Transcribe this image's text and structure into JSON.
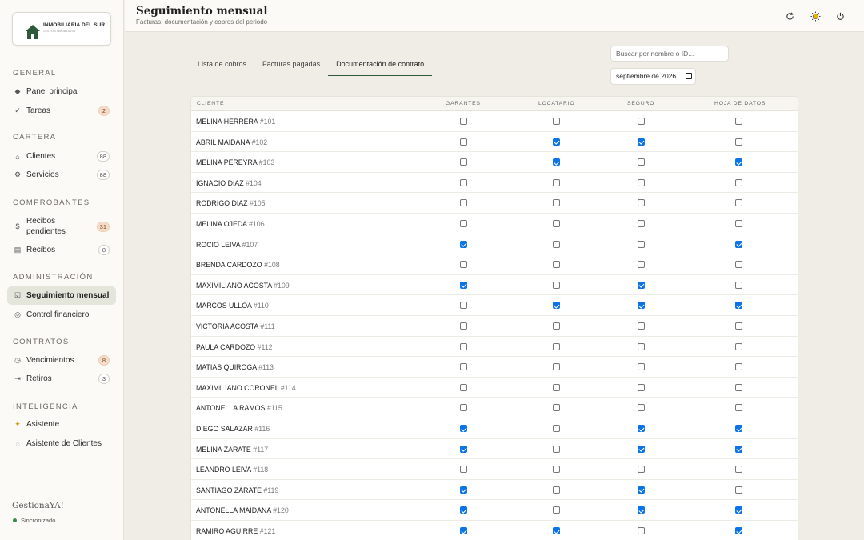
{
  "logo": {
    "title": "INMOBILIARIA DEL SUR",
    "subtitle": "GESTIÓN INMOBILIARIA"
  },
  "nav": [
    {
      "type": "section",
      "label": "GENERAL"
    },
    {
      "type": "item",
      "label": "Panel principal",
      "icon": "diamond-icon"
    },
    {
      "type": "item",
      "label": "Tareas",
      "icon": "check-icon",
      "badge": "2",
      "badge_style": "warn"
    },
    {
      "type": "section",
      "label": "CARTERA"
    },
    {
      "type": "item",
      "label": "Clientes",
      "icon": "home-icon",
      "badge": "88"
    },
    {
      "type": "item",
      "label": "Servicios",
      "icon": "gear-icon",
      "badge": "88"
    },
    {
      "type": "section",
      "label": "COMPROBANTES"
    },
    {
      "type": "item",
      "label": "Recibos pendientes",
      "icon": "dollar-icon",
      "badge": "31",
      "badge_style": "warn"
    },
    {
      "type": "item",
      "label": "Recibos",
      "icon": "receipt-icon",
      "badge": "8"
    },
    {
      "type": "section",
      "label": "ADMINISTRACIÓN"
    },
    {
      "type": "item",
      "label": "Seguimiento mensual",
      "icon": "checkbox-icon",
      "active": true
    },
    {
      "type": "item",
      "label": "Control financiero",
      "icon": "chart-icon"
    },
    {
      "type": "section",
      "label": "CONTRATOS"
    },
    {
      "type": "item",
      "label": "Vencimientos",
      "icon": "clock-icon",
      "badge": "8",
      "badge_style": "warn"
    },
    {
      "type": "item",
      "label": "Retiros",
      "icon": "exit-icon",
      "badge": "3"
    },
    {
      "type": "section",
      "label": "INTELIGENCIA"
    },
    {
      "type": "item",
      "label": "Asistente",
      "icon": "sparkle-icon"
    },
    {
      "type": "item",
      "label": "Asistente de Clientes",
      "icon": "chat-icon"
    }
  ],
  "brand": "GestionaYA!",
  "sync_status": "Sincronizado",
  "header": {
    "title": "Seguimiento mensual",
    "subtitle": "Facturas, documentación y cobros del periodo",
    "actions": [
      "refresh-icon",
      "sun-icon",
      "power-icon"
    ]
  },
  "tabs": [
    {
      "label": "Lista de cobros",
      "active": false
    },
    {
      "label": "Facturas pagadas",
      "active": false
    },
    {
      "label": "Documentación de contrato",
      "active": true
    }
  ],
  "search": {
    "placeholder": "Buscar por nombre o ID..."
  },
  "month": {
    "value": "septiembre de 2026"
  },
  "table": {
    "columns": [
      "CLIENTE",
      "GARANTES",
      "LOCATARIO",
      "SEGURO",
      "HOJA DE DATOS"
    ],
    "rows": [
      {
        "name": "MELINA HERRERA",
        "id": "#101",
        "checks": [
          false,
          false,
          false,
          false
        ]
      },
      {
        "name": "ABRIL MAIDANA",
        "id": "#102",
        "checks": [
          false,
          true,
          true,
          false
        ]
      },
      {
        "name": "MELINA PEREYRA",
        "id": "#103",
        "checks": [
          false,
          true,
          false,
          true
        ]
      },
      {
        "name": "IGNACIO DIAZ",
        "id": "#104",
        "checks": [
          false,
          false,
          false,
          false
        ]
      },
      {
        "name": "RODRIGO DIAZ",
        "id": "#105",
        "checks": [
          false,
          false,
          false,
          false
        ]
      },
      {
        "name": "MELINA OJEDA",
        "id": "#106",
        "checks": [
          false,
          false,
          false,
          false
        ]
      },
      {
        "name": "ROCIO LEIVA",
        "id": "#107",
        "checks": [
          true,
          false,
          false,
          true
        ]
      },
      {
        "name": "BRENDA CARDOZO",
        "id": "#108",
        "checks": [
          false,
          false,
          false,
          false
        ]
      },
      {
        "name": "MAXIMILIANO ACOSTA",
        "id": "#109",
        "checks": [
          true,
          false,
          true,
          false
        ]
      },
      {
        "name": "MARCOS ULLOA",
        "id": "#110",
        "checks": [
          false,
          true,
          true,
          true
        ]
      },
      {
        "name": "VICTORIA ACOSTA",
        "id": "#111",
        "checks": [
          false,
          false,
          false,
          false
        ]
      },
      {
        "name": "PAULA CARDOZO",
        "id": "#112",
        "checks": [
          false,
          false,
          false,
          false
        ]
      },
      {
        "name": "MATIAS QUIROGA",
        "id": "#113",
        "checks": [
          false,
          false,
          false,
          false
        ]
      },
      {
        "name": "MAXIMILIANO CORONEL",
        "id": "#114",
        "checks": [
          false,
          false,
          false,
          false
        ]
      },
      {
        "name": "ANTONELLA RAMOS",
        "id": "#115",
        "checks": [
          false,
          false,
          false,
          false
        ]
      },
      {
        "name": "DIEGO SALAZAR",
        "id": "#116",
        "checks": [
          true,
          false,
          true,
          true
        ]
      },
      {
        "name": "MELINA ZARATE",
        "id": "#117",
        "checks": [
          true,
          false,
          true,
          true
        ]
      },
      {
        "name": "LEANDRO LEIVA",
        "id": "#118",
        "checks": [
          false,
          false,
          false,
          false
        ]
      },
      {
        "name": "SANTIAGO ZARATE",
        "id": "#119",
        "checks": [
          true,
          false,
          true,
          false
        ]
      },
      {
        "name": "ANTONELLA MAIDANA",
        "id": "#120",
        "checks": [
          true,
          false,
          true,
          true
        ]
      },
      {
        "name": "RAMIRO AGUIRRE",
        "id": "#121",
        "checks": [
          true,
          true,
          false,
          true
        ]
      }
    ]
  }
}
